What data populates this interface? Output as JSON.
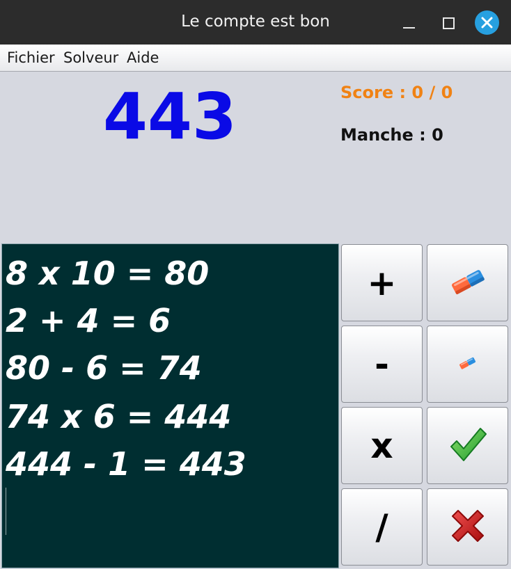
{
  "window": {
    "title": "Le compte est bon"
  },
  "menu": {
    "items": [
      "Fichier",
      "Solveur",
      "Aide"
    ]
  },
  "game": {
    "target": "443",
    "score": "Score : 0 / 0",
    "round": "Manche : 0"
  },
  "board": {
    "lines": [
      "8 x 10 = 80",
      "2 + 4 = 6",
      "80 - 6 = 74",
      "74 x 6 = 444",
      "444 - 1 = 443"
    ]
  },
  "operators": {
    "add": "+",
    "subtract": "-",
    "multiply": "x",
    "divide": "/"
  },
  "icons": {
    "clear_all": "eraser-icon",
    "clear_last": "small-eraser-icon",
    "validate": "check-icon",
    "cancel": "cross-icon"
  },
  "colors": {
    "target": "#0a0ae6",
    "score": "#f08214",
    "board_bg": "#002e31",
    "close_button": "#27a0e0"
  }
}
